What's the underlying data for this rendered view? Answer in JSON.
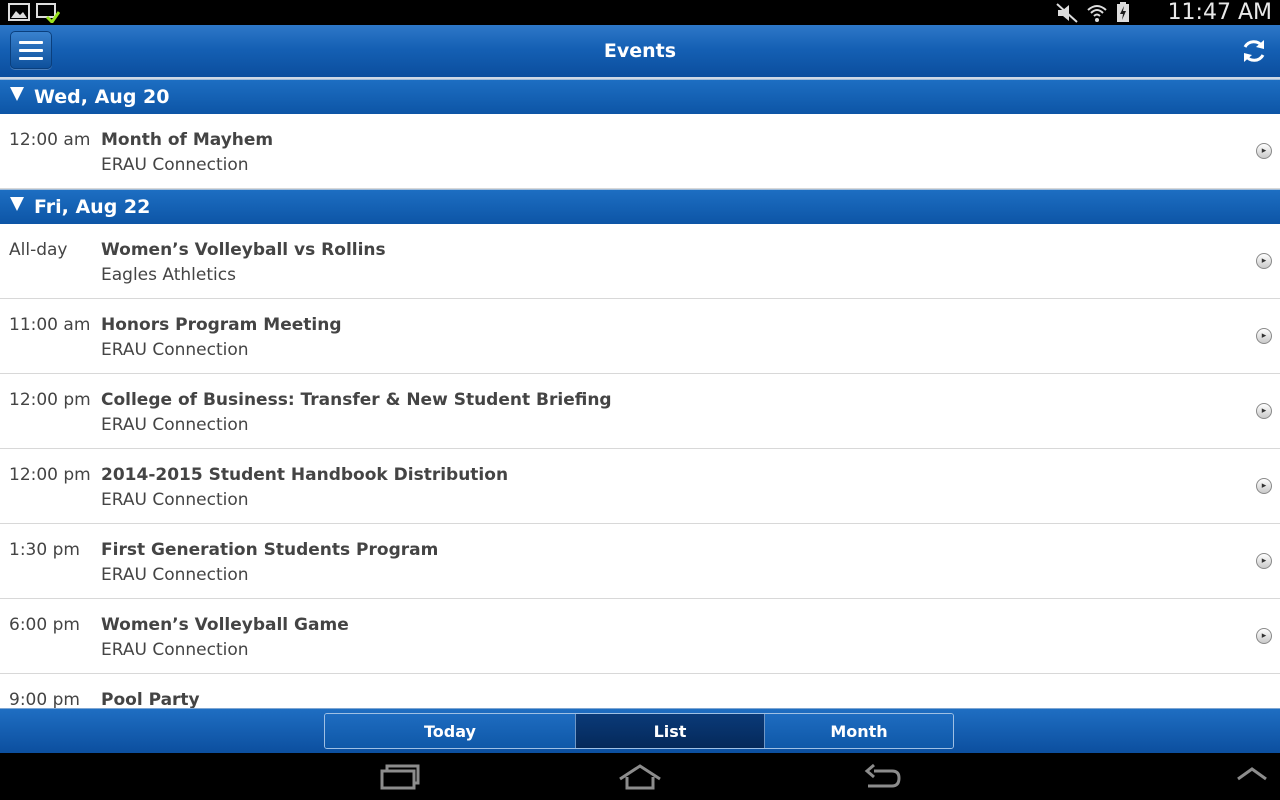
{
  "status_bar": {
    "time": "11:47 AM",
    "left_icons": [
      "gallery-icon",
      "download-check-icon"
    ],
    "right_icons": [
      "mute-icon",
      "wifi-icon",
      "battery-charging-icon"
    ]
  },
  "app_bar": {
    "title": "Events",
    "menu_icon": "hamburger-menu-icon",
    "refresh_icon": "refresh-icon"
  },
  "days": [
    {
      "label": "Wed, Aug 20",
      "events": [
        {
          "time": "12:00 am",
          "title": "Month of Mayhem",
          "calendar": "ERAU Connection"
        }
      ]
    },
    {
      "label": "Fri, Aug 22",
      "events": [
        {
          "time": "All-day",
          "title": "Women’s Volleyball vs  Rollins",
          "calendar": "Eagles Athletics"
        },
        {
          "time": "11:00 am",
          "title": "Honors Program Meeting",
          "calendar": "ERAU Connection"
        },
        {
          "time": "12:00 pm",
          "title": "College of Business: Transfer & New Student Briefing",
          "calendar": "ERAU Connection"
        },
        {
          "time": "12:00 pm",
          "title": "2014-2015 Student Handbook Distribution",
          "calendar": "ERAU Connection"
        },
        {
          "time": "1:30 pm",
          "title": "First Generation Students Program",
          "calendar": "ERAU Connection"
        },
        {
          "time": "6:00 pm",
          "title": "Women’s Volleyball Game",
          "calendar": "ERAU Connection"
        },
        {
          "time": "9:00 pm",
          "title": "Pool Party",
          "calendar": ""
        }
      ]
    }
  ],
  "tabs": [
    {
      "label": "Today",
      "selected": false
    },
    {
      "label": "List",
      "selected": true
    },
    {
      "label": "Month",
      "selected": false
    }
  ],
  "nav_bar": {
    "icons": [
      "recent-apps-icon",
      "home-icon",
      "back-icon",
      "expand-up-icon"
    ]
  },
  "colors": {
    "header_blue": "#1560b4",
    "selected_tab": "#05295a",
    "text": "#444444"
  }
}
